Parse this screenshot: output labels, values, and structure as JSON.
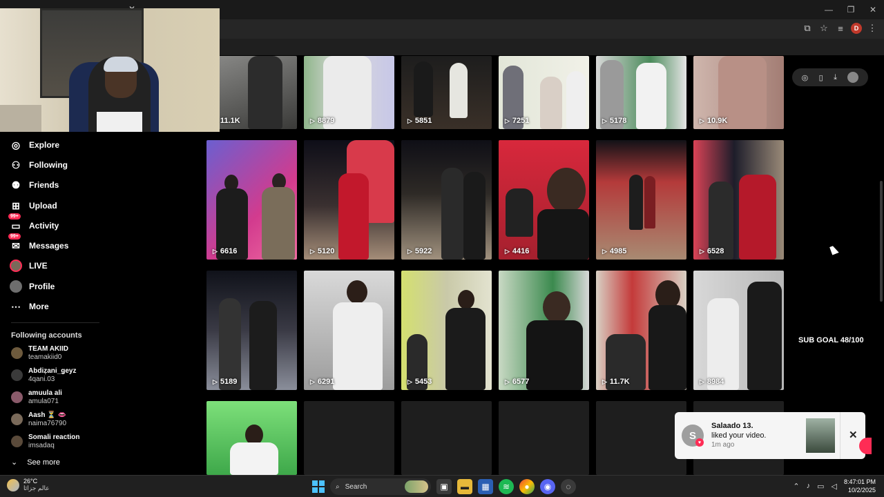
{
  "browser": {
    "tab_title": "",
    "window_controls": [
      "—",
      "❐",
      "✕"
    ],
    "profile_initial": "D"
  },
  "sidebar": {
    "nav": [
      {
        "label": "Explore",
        "icon": "compass-icon"
      },
      {
        "label": "Following",
        "icon": "following-icon"
      },
      {
        "label": "Friends",
        "icon": "friends-icon"
      },
      {
        "label": "Upload",
        "icon": "upload-icon"
      },
      {
        "label": "Activity",
        "icon": "activity-icon",
        "badge": "99+"
      },
      {
        "label": "Messages",
        "icon": "messages-icon",
        "badge": "99+"
      },
      {
        "label": "LIVE",
        "icon": "live-icon"
      },
      {
        "label": "Profile",
        "icon": "profile-avatar"
      },
      {
        "label": "More",
        "icon": "more-icon"
      }
    ],
    "following_title": "Following accounts",
    "accounts": [
      {
        "name": "TEAM AKIID",
        "handle": "teamakiid0",
        "color": "#6d5a3d"
      },
      {
        "name": "Abdiẓani_ǥeyz",
        "handle": "4qani.03",
        "color": "#3a3a3a"
      },
      {
        "name": "amuula ali",
        "handle": "amula071",
        "color": "#8a5a6a"
      },
      {
        "name": "Aash ⏳ 👄",
        "handle": "naima76790",
        "color": "#7a6a5a"
      },
      {
        "name": "Somali reaction",
        "handle": "imsadaq",
        "color": "#5a4a3a"
      }
    ],
    "see_more": "See more"
  },
  "grid": {
    "row1": [
      "11.1K",
      "8879",
      "5851",
      "7251",
      "5178",
      "10.9K"
    ],
    "row2": [
      "6616",
      "5120",
      "5922",
      "4416",
      "4985",
      "6528"
    ],
    "row3": [
      "5189",
      "6291",
      "5453",
      "6577",
      "11.7K",
      "8984"
    ]
  },
  "sub_goal": "SUB GOAL 48/100",
  "notification": {
    "avatar_letter": "S",
    "name": "Salaado 13.",
    "message": "liked your video.",
    "time": "1m ago"
  },
  "taskbar": {
    "temp": "26°C",
    "weather_text": "عالم جزائا",
    "search_placeholder": "Search",
    "time": "8:47:01 PM",
    "date": "10/2/2025"
  }
}
